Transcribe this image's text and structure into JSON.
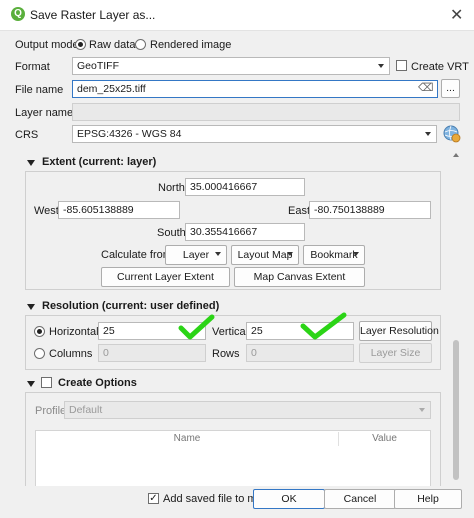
{
  "window": {
    "title": "Save Raster Layer as...",
    "logo_letter": "Q",
    "close_glyph": "✕"
  },
  "output_mode": {
    "label": "Output mode",
    "raw_label": "Raw data",
    "rendered_label": "Rendered image",
    "selected": "Raw data"
  },
  "format": {
    "label": "Format",
    "value": "GeoTIFF",
    "create_vrt_label": "Create VRT",
    "create_vrt_checked": false
  },
  "file_name": {
    "label": "File name",
    "value": "dem_25x25.tiff",
    "clear_glyph": "⌫",
    "browse_label": "..."
  },
  "layer_name": {
    "label": "Layer name",
    "value": ""
  },
  "crs": {
    "label": "CRS",
    "value": "EPSG:4326 - WGS 84"
  },
  "extent": {
    "title": "Extent (current: layer)",
    "north_label": "North",
    "north": "35.000416667",
    "west_label": "West",
    "west": "-85.605138889",
    "east_label": "East",
    "east": "-80.750138889",
    "south_label": "South",
    "south": "30.355416667",
    "calc_from_label": "Calculate from",
    "layer_btn": "Layer",
    "layout_map_btn": "Layout Map",
    "bookmark_btn": "Bookmark",
    "current_layer_extent_btn": "Current Layer Extent",
    "map_canvas_extent_btn": "Map Canvas Extent"
  },
  "resolution": {
    "title": "Resolution (current: user defined)",
    "horizontal_label": "Horizontal",
    "horizontal": "25",
    "vertical_label": "Vertical",
    "vertical": "25",
    "layer_resolution_btn": "Layer Resolution",
    "columns_label": "Columns",
    "columns": "0",
    "rows_label": "Rows",
    "rows": "0",
    "layer_size_btn": "Layer Size",
    "selected": "Horizontal",
    "annotation_color": "#2bd416"
  },
  "create_options": {
    "title": "Create Options",
    "checked": false,
    "profile_label": "Profile",
    "profile_value": "Default",
    "columns": [
      "Name",
      "Value"
    ]
  },
  "footer": {
    "add_saved_label": "Add saved file to map",
    "add_saved_checked": true,
    "ok": "OK",
    "cancel": "Cancel",
    "help": "Help"
  },
  "colors": {
    "accent": "#3477c5",
    "qgis_green": "#5aaf3c"
  }
}
